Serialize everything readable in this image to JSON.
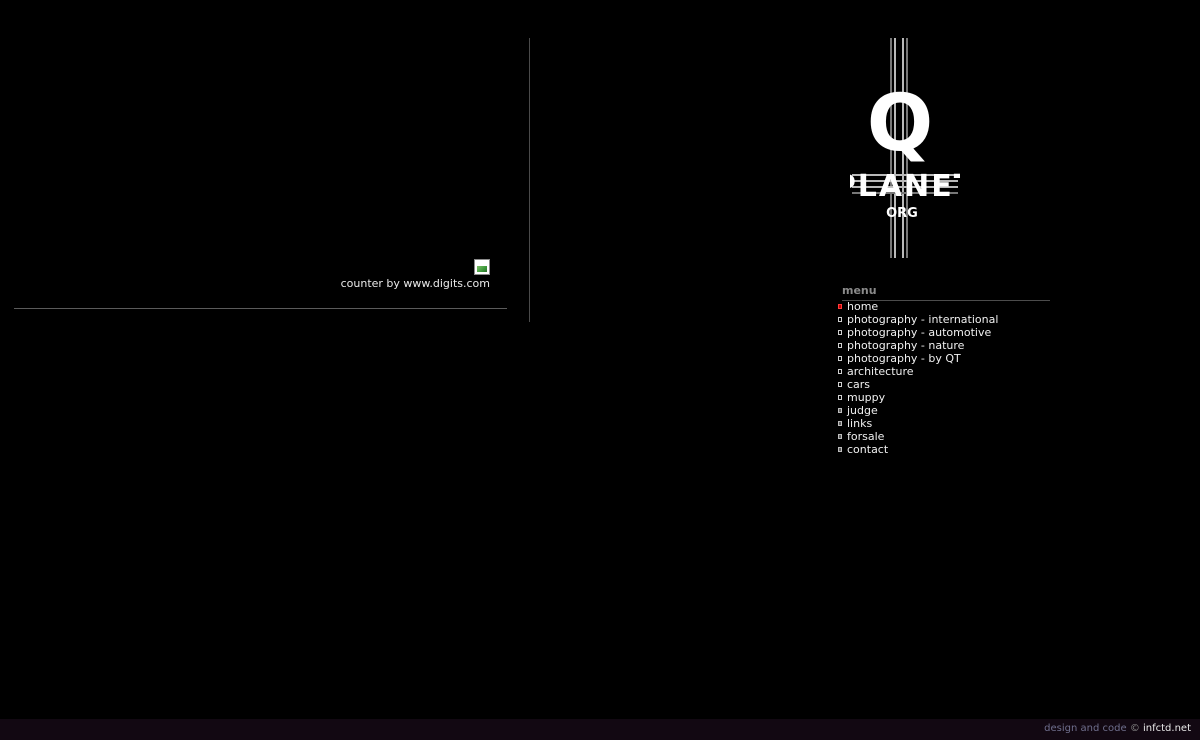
{
  "counter": {
    "text": "counter by www.digits.com"
  },
  "logo": {
    "line1": "Q",
    "line2": "PLANET",
    "line3": "ORG"
  },
  "menu": {
    "title": "menu",
    "items": [
      {
        "label": "home",
        "active": true
      },
      {
        "label": "photography - international"
      },
      {
        "label": "photography - automotive"
      },
      {
        "label": "photography - nature"
      },
      {
        "label": "photography - by QT"
      },
      {
        "label": "architecture"
      },
      {
        "label": "cars"
      },
      {
        "label": "muppy"
      },
      {
        "label": "judge"
      },
      {
        "label": "links"
      },
      {
        "label": "forsale"
      },
      {
        "label": "contact"
      }
    ]
  },
  "footer": {
    "text": "design and code",
    "copyright": "©",
    "brand": "infctd.net"
  }
}
